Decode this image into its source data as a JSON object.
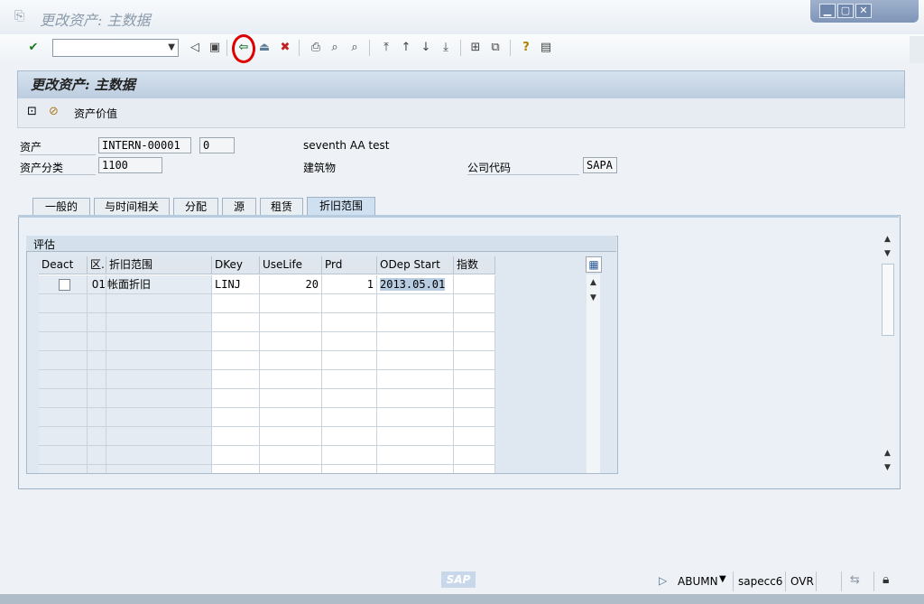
{
  "window": {
    "title": "更改资产: 主数据",
    "controls": {
      "minimize": "▁",
      "maximize": "▢",
      "close": "✕"
    }
  },
  "toolbar": {
    "command_field_value": "",
    "icons": [
      "enter-icon",
      "back-nav-icon",
      "save-icon",
      "back-icon",
      "exit-icon",
      "cancel-icon",
      "print-icon",
      "find-icon",
      "find-next-icon",
      "first-page-icon",
      "previous-page-icon",
      "next-page-icon",
      "last-page-icon",
      "new-session-icon",
      "shortcut-icon",
      "help-icon",
      "layout-icon"
    ]
  },
  "header": {
    "title": "更改资产: 主数据"
  },
  "app_toolbar": {
    "asset_values_label": "资产价值"
  },
  "form": {
    "asset_label": "资产",
    "asset_number": "INTERN-00001",
    "asset_sub": "0",
    "asset_description": "seventh AA test",
    "asset_class_label": "资产分类",
    "asset_class": "1100",
    "asset_class_desc": "建筑物",
    "company_code_label": "公司代码",
    "company_code": "SAPA"
  },
  "tabs": [
    {
      "label": "一般的",
      "active": false
    },
    {
      "label": "与时间相关",
      "active": false
    },
    {
      "label": "分配",
      "active": false
    },
    {
      "label": "源",
      "active": false
    },
    {
      "label": "租赁",
      "active": false
    },
    {
      "label": "折旧范围",
      "active": true
    }
  ],
  "evaluation": {
    "title": "评估",
    "columns": [
      "Deact",
      "区.",
      "折旧范围",
      "DKey",
      "UseLife",
      "Prd",
      "ODep Start",
      "指数"
    ],
    "rows": [
      {
        "deact": false,
        "area": "01",
        "area_name": "帐面折旧",
        "dkey": "LINJ",
        "uselife": "20",
        "prd": "1",
        "odep_start": "2013.05.01",
        "index": ""
      }
    ]
  },
  "status": {
    "system": "ABUMN",
    "server": "sapecc6",
    "mode": "OVR",
    "logo": "SAP"
  },
  "colors": {
    "accent": "#bccde0",
    "highlight": "#d00000"
  }
}
